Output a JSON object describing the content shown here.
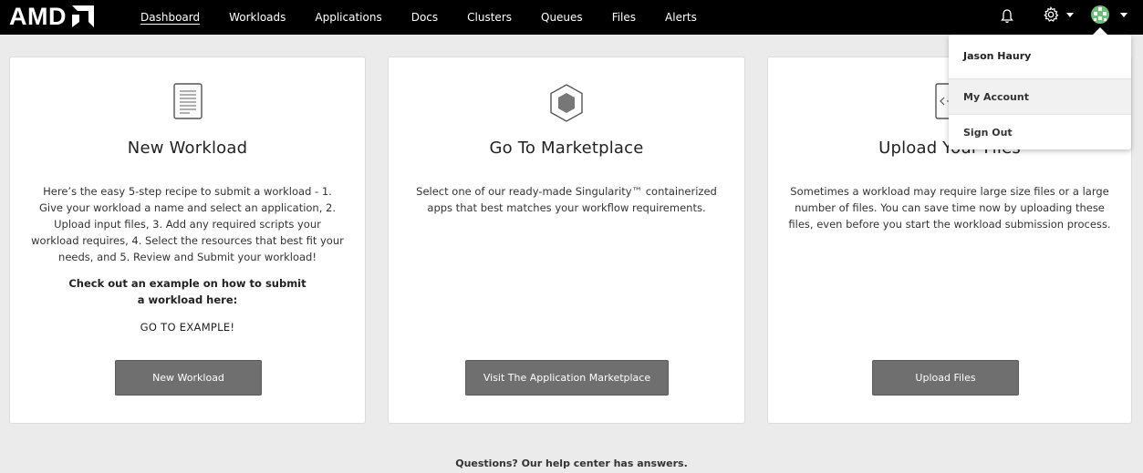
{
  "brand": {
    "logo_text": "AMD",
    "logo_icon": "amd-arrow-logo"
  },
  "nav": {
    "items": [
      {
        "label": "Dashboard",
        "active": true
      },
      {
        "label": "Workloads"
      },
      {
        "label": "Applications"
      },
      {
        "label": "Docs"
      },
      {
        "label": "Clusters"
      },
      {
        "label": "Queues"
      },
      {
        "label": "Files"
      },
      {
        "label": "Alerts"
      }
    ]
  },
  "topbar_icons": [
    "bell-icon",
    "gear-icon",
    "chevron-down-icon",
    "avatar",
    "chevron-down-icon"
  ],
  "cards": [
    {
      "icon": "document-icon",
      "title": "New Workload",
      "body": "Here’s the easy 5-step recipe to submit a workload - 1. Give your workload a name and select an application, 2. Upload input files, 3. Add any required scripts your workload requires, 4. Select the resources that best fit your needs, and 5. Review and Submit your workload!",
      "strong_line1": "Check out an example on how to submit",
      "strong_line2": "a workload here:",
      "link": "GO TO EXAMPLE!",
      "button": "New Workload"
    },
    {
      "icon": "hexagon-icon",
      "title": "Go To Marketplace",
      "body": "Select one of our ready-made Singularity™ containerized apps that best matches your workflow requirements.",
      "button": "Visit The Application Marketplace"
    },
    {
      "icon": "code-file-icon",
      "title": "Upload Your Files",
      "body": "Sometimes a workload may require large size files or a large number of files. You can save time now by uploading these files, even before you start the workload submission process.",
      "button": "Upload Files"
    }
  ],
  "footer": {
    "text": "Questions? Our help center has answers."
  },
  "user_menu": {
    "name": "Jason Haury",
    "items": [
      {
        "label": "My Account"
      },
      {
        "label": "Sign Out"
      }
    ]
  },
  "colors": {
    "topbar": "#000000",
    "background": "#ebebeb",
    "button": "#6f6f6f",
    "avatar": "#6cc07a"
  }
}
